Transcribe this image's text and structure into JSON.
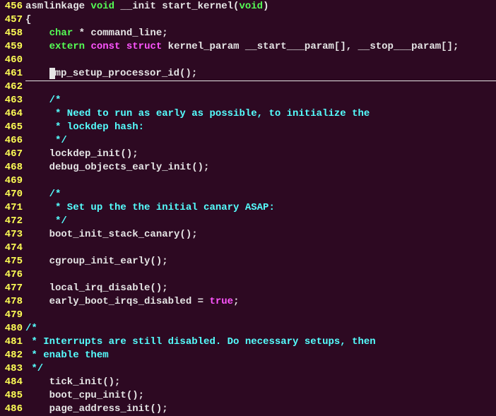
{
  "lines": [
    {
      "num": "456",
      "segments": [
        {
          "text": "asmlinkage ",
          "cls": "ident"
        },
        {
          "text": "void",
          "cls": "kw-type"
        },
        {
          "text": " __init start_kernel(",
          "cls": "ident"
        },
        {
          "text": "void",
          "cls": "kw-type"
        },
        {
          "text": ")",
          "cls": "ident"
        }
      ]
    },
    {
      "num": "457",
      "segments": [
        {
          "text": "{",
          "cls": "brace"
        }
      ]
    },
    {
      "num": "458",
      "segments": [
        {
          "text": "    ",
          "cls": ""
        },
        {
          "text": "char",
          "cls": "kw-type"
        },
        {
          "text": " * command_line;",
          "cls": "ident"
        }
      ]
    },
    {
      "num": "459",
      "segments": [
        {
          "text": "    ",
          "cls": ""
        },
        {
          "text": "extern",
          "cls": "kw-storage"
        },
        {
          "text": " ",
          "cls": ""
        },
        {
          "text": "const",
          "cls": "kw-const"
        },
        {
          "text": " ",
          "cls": ""
        },
        {
          "text": "struct",
          "cls": "kw-struct"
        },
        {
          "text": " kernel_param __start___param[], __stop___param[];",
          "cls": "ident"
        }
      ]
    },
    {
      "num": "460",
      "segments": []
    },
    {
      "num": "461",
      "cursor": true,
      "segments": [
        {
          "text": "    ",
          "cls": ""
        },
        {
          "text": "s",
          "cls": "cursor-char"
        },
        {
          "text": "mp_setup_processor_id();                                                   ",
          "cls": "ident"
        }
      ]
    },
    {
      "num": "462",
      "segments": []
    },
    {
      "num": "463",
      "segments": [
        {
          "text": "    ",
          "cls": ""
        },
        {
          "text": "/*",
          "cls": "comment"
        }
      ]
    },
    {
      "num": "464",
      "segments": [
        {
          "text": "     * Need to run as early as possible, to initialize the",
          "cls": "comment"
        }
      ]
    },
    {
      "num": "465",
      "segments": [
        {
          "text": "     * lockdep hash:",
          "cls": "comment"
        }
      ]
    },
    {
      "num": "466",
      "segments": [
        {
          "text": "     */",
          "cls": "comment"
        }
      ]
    },
    {
      "num": "467",
      "segments": [
        {
          "text": "    lockdep_init();",
          "cls": "ident"
        }
      ]
    },
    {
      "num": "468",
      "segments": [
        {
          "text": "    debug_objects_early_init();",
          "cls": "ident"
        }
      ]
    },
    {
      "num": "469",
      "segments": []
    },
    {
      "num": "470",
      "segments": [
        {
          "text": "    ",
          "cls": ""
        },
        {
          "text": "/*",
          "cls": "comment"
        }
      ]
    },
    {
      "num": "471",
      "segments": [
        {
          "text": "     * Set up the the initial canary ASAP:",
          "cls": "comment"
        }
      ]
    },
    {
      "num": "472",
      "segments": [
        {
          "text": "     */",
          "cls": "comment"
        }
      ]
    },
    {
      "num": "473",
      "segments": [
        {
          "text": "    boot_init_stack_canary();",
          "cls": "ident"
        }
      ]
    },
    {
      "num": "474",
      "segments": []
    },
    {
      "num": "475",
      "segments": [
        {
          "text": "    cgroup_init_early();",
          "cls": "ident"
        }
      ]
    },
    {
      "num": "476",
      "segments": []
    },
    {
      "num": "477",
      "segments": [
        {
          "text": "    local_irq_disable();",
          "cls": "ident"
        }
      ]
    },
    {
      "num": "478",
      "segments": [
        {
          "text": "    early_boot_irqs_disabled = ",
          "cls": "ident"
        },
        {
          "text": "true",
          "cls": "kw-bool"
        },
        {
          "text": ";",
          "cls": "ident"
        }
      ]
    },
    {
      "num": "479",
      "segments": []
    },
    {
      "num": "480",
      "segments": [
        {
          "text": "/*",
          "cls": "comment"
        }
      ]
    },
    {
      "num": "481",
      "segments": [
        {
          "text": " * Interrupts are still disabled. Do necessary setups, then",
          "cls": "comment"
        }
      ]
    },
    {
      "num": "482",
      "segments": [
        {
          "text": " * enable them",
          "cls": "comment"
        }
      ]
    },
    {
      "num": "483",
      "segments": [
        {
          "text": " */",
          "cls": "comment"
        }
      ]
    },
    {
      "num": "484",
      "segments": [
        {
          "text": "    tick_init();",
          "cls": "ident"
        }
      ]
    },
    {
      "num": "485",
      "segments": [
        {
          "text": "    boot_cpu_init();",
          "cls": "ident"
        }
      ]
    },
    {
      "num": "486",
      "segments": [
        {
          "text": "    page_address_init();",
          "cls": "ident"
        }
      ]
    }
  ]
}
